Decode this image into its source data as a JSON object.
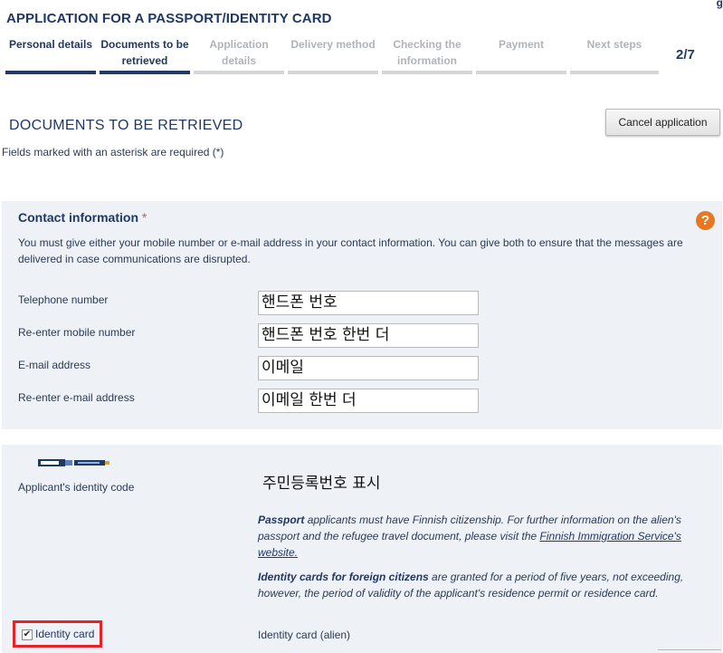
{
  "header": {
    "title": "APPLICATION FOR A PASSPORT/IDENTITY CARD",
    "corner_text": "g",
    "step_counter": "2/7"
  },
  "steps": [
    {
      "label": "Personal details",
      "state": "done"
    },
    {
      "label": "Documents to be retrieved",
      "state": "active"
    },
    {
      "label": "Application details",
      "state": "todo"
    },
    {
      "label": "Delivery method",
      "state": "todo"
    },
    {
      "label": "Checking the information",
      "state": "todo"
    },
    {
      "label": "Payment",
      "state": "todo"
    },
    {
      "label": "Next steps",
      "state": "todo"
    }
  ],
  "page": {
    "heading": "DOCUMENTS TO BE RETRIEVED",
    "cancel_label": "Cancel application",
    "required_note": "Fields marked with an asterisk are required (*)"
  },
  "contact": {
    "title": "Contact information",
    "asterisk": "*",
    "help_symbol": "?",
    "description": "You must give either your mobile number or e-mail address in your contact information. You can give both to ensure that the messages are delivered in case communications are disrupted.",
    "fields": [
      {
        "label": "Telephone number",
        "value": "핸드폰 번호"
      },
      {
        "label": "Re-enter mobile number",
        "value": "핸드폰 번호 한번 더"
      },
      {
        "label": "E-mail address",
        "value": "이메일"
      },
      {
        "label": "Re-enter e-mail address",
        "value": "이메일 한번 더"
      }
    ]
  },
  "identity": {
    "icon": "id-card-strip-icon",
    "label": "Applicant's identity code",
    "value": "주민등록번호 표시",
    "passport_bold": "Passport",
    "passport_text": " applicants must have Finnish citizenship. For further information on the alien's passport and the refugee travel document, please visit the ",
    "passport_link": "Finnish Immigration Service's website.",
    "idcard_bold": "Identity cards for foreign citizens",
    "idcard_text": " are granted for a period of five years, not exceeding, however, the period of validity of the applicant's residence permit or residence card.",
    "checkbox_label": "Identity card",
    "checkbox_checked": true,
    "checkbox_mark": "✔",
    "alien_label": "Identity card (alien)"
  },
  "colors": {
    "primary": "#1f3864",
    "panel_bg": "#eef1f5",
    "help": "#e87722",
    "highlight": "#e3222a"
  }
}
